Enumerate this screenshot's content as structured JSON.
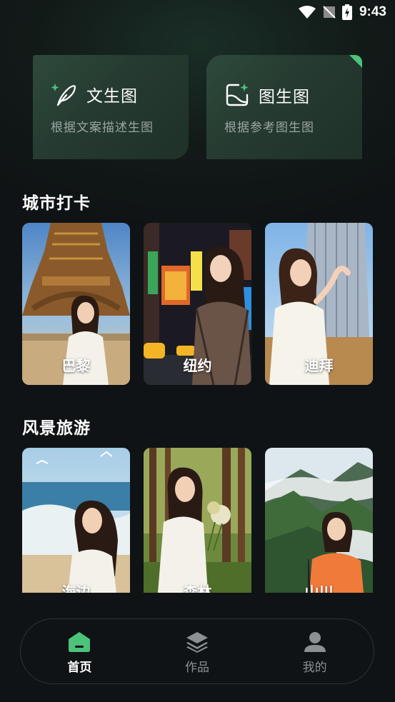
{
  "status": {
    "time": "9:43"
  },
  "features": [
    {
      "title": "文生图",
      "subtitle": "根据文案描述生图",
      "icon": "feather-sparkle-icon"
    },
    {
      "title": "图生图",
      "subtitle": "根据参考图生图",
      "icon": "image-sparkle-icon"
    }
  ],
  "sections": {
    "city": {
      "title": "城市打卡",
      "items": [
        {
          "label": "巴黎"
        },
        {
          "label": "纽约"
        },
        {
          "label": "迪拜"
        }
      ]
    },
    "scenery": {
      "title": "风景旅游",
      "items": [
        {
          "label": "海边"
        },
        {
          "label": "森林"
        },
        {
          "label": "山川"
        }
      ]
    }
  },
  "tabs": [
    {
      "label": "首页",
      "icon": "home-icon",
      "active": true
    },
    {
      "label": "作品",
      "icon": "layers-icon",
      "active": false
    },
    {
      "label": "我的",
      "icon": "user-icon",
      "active": false
    }
  ],
  "colors": {
    "accent": "#4cc27a",
    "background": "#0f1315",
    "card": "#2a4236"
  }
}
